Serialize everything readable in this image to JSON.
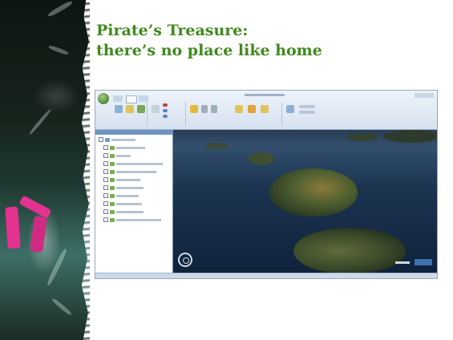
{
  "slide": {
    "title_line1": "Pirate’s Treasure:",
    "title_line2": "there’s no place like home"
  },
  "colors": {
    "title": "#3f8a1e",
    "chalk_pink": "#e3328f",
    "ribbon": "#d6e2f0",
    "ocean": "#1c3451"
  },
  "icons": [
    "app-orb-icon",
    "navigation-control-icon",
    "folder-icon",
    "globe-icon"
  ]
}
